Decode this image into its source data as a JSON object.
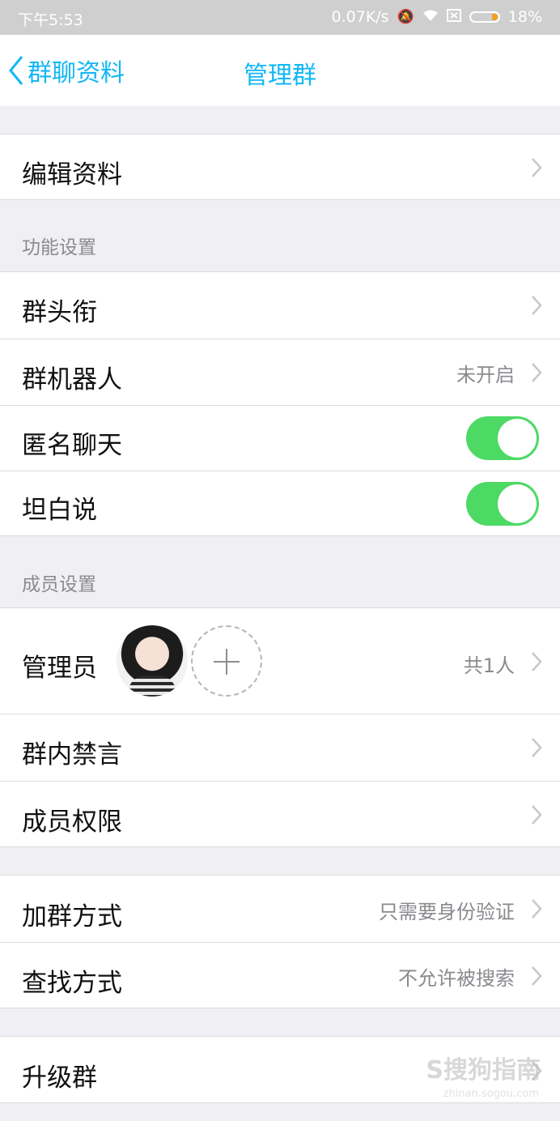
{
  "status_bar": {
    "time": "下午5:53",
    "network_speed": "0.07K/s",
    "battery": "18%",
    "icons": [
      "silent-icon",
      "wifi-icon",
      "sim-icon",
      "battery-icon"
    ]
  },
  "nav": {
    "back_label": "群聊资料",
    "title": "管理群"
  },
  "rows": {
    "edit_profile": "编辑资料",
    "section_function": "功能设置",
    "group_title": "群头衔",
    "group_robot": "群机器人",
    "group_robot_value": "未开启",
    "anonymous_chat": "匿名聊天",
    "honest_talk": "坦白说",
    "section_members": "成员设置",
    "admins": "管理员",
    "admins_count": "共1人",
    "mute": "群内禁言",
    "member_permissions": "成员权限",
    "join_method": "加群方式",
    "join_method_value": "只需要身份验证",
    "search_method": "查找方式",
    "search_method_value": "不允许被搜索",
    "upgrade": "升级群"
  },
  "toggles": {
    "anonymous_chat_on": true,
    "honest_talk_on": true
  },
  "watermark": {
    "text": "S搜狗指南",
    "url": "zhinan.sogou.com"
  },
  "colors": {
    "accent": "#12b7f5",
    "toggle_on": "#4cd964",
    "background": "#efeff4"
  }
}
